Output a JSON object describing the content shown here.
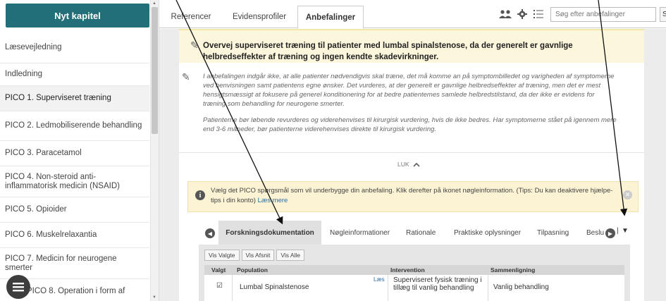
{
  "sidebar": {
    "new_chapter": "Nyt kapitel",
    "items": [
      {
        "label": "Læsevejledning",
        "active": false
      },
      {
        "label": "Indledning",
        "active": false
      },
      {
        "label": "PICO 1. Superviseret træning",
        "active": true
      },
      {
        "label": "PICO 2. Ledmobiliserende behandling",
        "active": false
      },
      {
        "label": "PICO 3. Paracetamol",
        "active": false
      },
      {
        "label": "PICO 4. Non-steroid anti-inflammatorisk medicin (NSAID)",
        "active": false
      },
      {
        "label": "PICO 5. Opioider",
        "active": false
      },
      {
        "label": "PICO 6. Muskelrelaxantia",
        "active": false
      },
      {
        "label": "PICO 7. Medicin for neurogene smerter",
        "active": false
      },
      {
        "label": "PICO 8. Operation i form af",
        "active": false
      }
    ]
  },
  "top_tabs": [
    {
      "label": "Referencer",
      "active": false
    },
    {
      "label": "Evidensprofiler",
      "active": false
    },
    {
      "label": "Anbefalinger",
      "active": true
    }
  ],
  "toolbar": {
    "icons": [
      "users-icon",
      "gear-icon",
      "list-icon"
    ]
  },
  "search": {
    "placeholder": "Søg efter anbefalinger",
    "button_label": "S"
  },
  "recommendation": {
    "text": "Overvej superviseret træning til patienter med lumbal spinalstenose, da der generelt er gavnlige helbredseffekter af træning og ingen kendte skadevirkninger."
  },
  "remark": {
    "paragraph1": "I anbefalingen indgår ikke, at alle patienter nødvendigvis skal træne, det må komme an på symptombilledet og varigheden af symptomerne ved henvisningen samt patientens egne ønsker. Det vurderes, at der generelt er gavnlige helbredseffekter af træning, men det er mest hensigtsmæssigt at fokusere på generel konditionering for at bedre patientemes samlede helbredstilstand, da der ikke er evidens for træning som behandling for neurogene smerter.",
    "paragraph2": "Patienterne bør løbende revurderes og viderehenvises til kirurgisk vurdering, hvis de ikke bedres. Har symptomerne stået på igennem mere end 3-6 måneder, bør patienterne viderehenvises direkte til kirurgisk vurdering."
  },
  "collapse": {
    "label": "LUK"
  },
  "help": {
    "text": "Vælg det PICO spørgsmål som vil underbygge din anbefaling. Klik derefter på ikonet nøgleinformation. (Tips: Du kan deaktivere hjælpe-tips i din konto)",
    "link": "Læs mere"
  },
  "sub_tabs": [
    {
      "label": "Forskningsdokumentation",
      "active": true
    },
    {
      "label": "Nøgleinformationer",
      "active": false
    },
    {
      "label": "Rationale",
      "active": false
    },
    {
      "label": "Praktiske oplysninger",
      "active": false
    },
    {
      "label": "Tilpasning",
      "active": false
    },
    {
      "label": "Beslu",
      "active": false
    }
  ],
  "view_buttons": [
    "Vis Valgte",
    "Vis Afsnit",
    "Vis Alle"
  ],
  "table": {
    "headers": [
      "Valgt",
      "Population",
      "Intervention",
      "Sammenligning"
    ],
    "rows": [
      {
        "selected": true,
        "population": "Lumbal Spinalstenose",
        "read_link": "Læs",
        "intervention": "Superviseret fysisk træning i tillæg til vanlig behandling",
        "comparison": "Vanlig behandling"
      }
    ]
  }
}
